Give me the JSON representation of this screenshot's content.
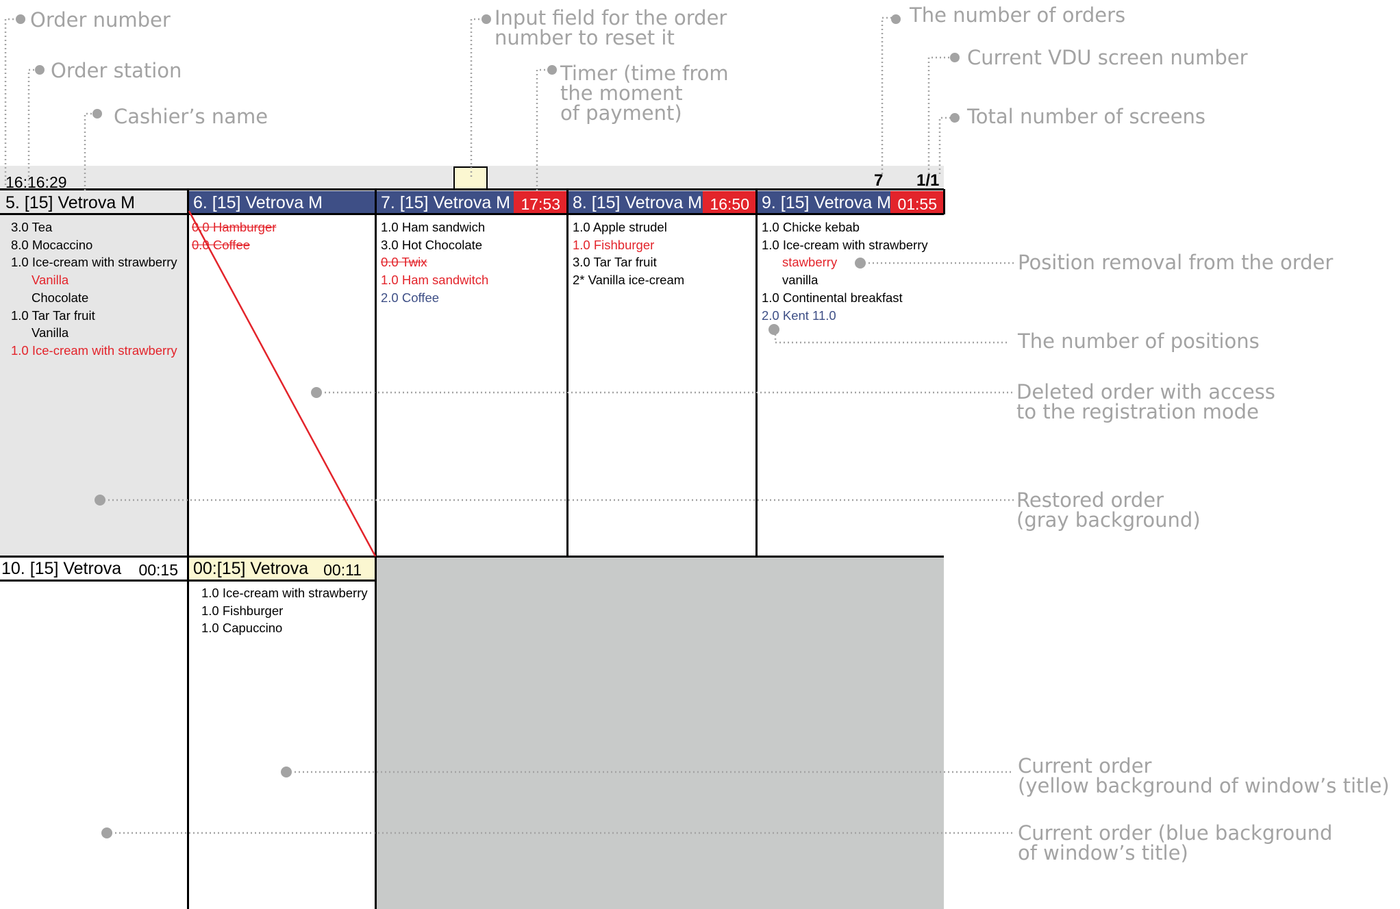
{
  "callouts": {
    "order_number": "Order number",
    "order_station": "Order station",
    "cashier_name": "Cashier’s name",
    "input_field": [
      "Input field for the order",
      "number to reset it"
    ],
    "timer": [
      "Timer (time from",
      "the moment",
      "of payment)"
    ],
    "number_of_orders": "The number of orders",
    "current_screen": "Current VDU screen number",
    "total_screens": "Total number of screens",
    "position_removal": "Position removal from the order",
    "number_of_positions": "The number of positions",
    "deleted_order": [
      "Deleted order with access",
      "to the registration mode"
    ],
    "restored_order": [
      "Restored order",
      "(gray background)"
    ],
    "current_order_yellow": [
      "Current order",
      "(yellow background of window’s title)"
    ],
    "current_order_blue": [
      "Current order (blue background",
      "of window’s title)"
    ]
  },
  "screen": {
    "clock": "16:16:29",
    "orders_count": "7",
    "screen_indicator": "1/1"
  },
  "orders": [
    {
      "title": "5. [15] Vetrova M",
      "header_style": "gray",
      "timer": "",
      "items": [
        {
          "text": "3.0 Tea",
          "style": "normal"
        },
        {
          "text": "8.0 Mocaccino",
          "style": "normal"
        },
        {
          "text": "1.0 Ice-cream with strawberry",
          "style": "normal"
        },
        {
          "text": "Vanilla",
          "style": "red",
          "indent": true
        },
        {
          "text": "Chocolate",
          "style": "normal",
          "indent": true
        },
        {
          "text": "1.0 Tar Tar fruit",
          "style": "normal"
        },
        {
          "text": "Vanilla",
          "style": "normal",
          "indent": true
        },
        {
          "text": "1.0 Ice-cream with strawberry",
          "style": "red"
        }
      ]
    },
    {
      "title": "6. [15] Vetrova M",
      "header_style": "blue",
      "timer": "",
      "items": [
        {
          "text": "0.0 Hamburger",
          "style": "strike"
        },
        {
          "text": "0.0 Coffee",
          "style": "strike"
        }
      ]
    },
    {
      "title": "7. [15] Vetrova M",
      "header_style": "blue",
      "timer": "17:53",
      "items": [
        {
          "text": "1.0 Ham sandwich",
          "style": "normal"
        },
        {
          "text": "3.0 Hot Chocolate",
          "style": "normal"
        },
        {
          "text": "0.0 Twix",
          "style": "strike"
        },
        {
          "text": "1.0 Ham sandwitch",
          "style": "red"
        },
        {
          "text": "2.0 Coffee",
          "style": "blue"
        }
      ]
    },
    {
      "title": "8. [15] Vetrova M",
      "header_style": "blue",
      "timer": "16:50",
      "items": [
        {
          "text": "1.0 Apple strudel",
          "style": "normal"
        },
        {
          "text": "1.0 Fishburger",
          "style": "red"
        },
        {
          "text": "3.0 Tar Tar fruit",
          "style": "normal"
        },
        {
          "text": "2* Vanilla ice-cream",
          "style": "normal"
        }
      ]
    },
    {
      "title": "9. [15] Vetrova M",
      "header_style": "blue",
      "timer": "01:55",
      "items": [
        {
          "text": "1.0 Chicke kebab",
          "style": "normal"
        },
        {
          "text": "1.0 Ice-cream with strawberry",
          "style": "normal"
        },
        {
          "text": "stawberry",
          "style": "red",
          "indent": true
        },
        {
          "text": "vanilla",
          "style": "normal",
          "indent": true
        },
        {
          "text": "1.0 Continental breakfast",
          "style": "normal"
        },
        {
          "text": "2.0 Kent 11.0",
          "style": "blue"
        }
      ]
    },
    {
      "title": "10. [15] Vetrova",
      "header_style": "white",
      "timer_plain": "00:15",
      "items": []
    },
    {
      "title": "00:[15] Vetrova",
      "header_style": "yellow",
      "timer_plain": "00:11",
      "items": [
        {
          "text": "1.0 Ice-cream with strawberry",
          "style": "normal"
        },
        {
          "text": "1.0 Fishburger",
          "style": "normal"
        },
        {
          "text": "1.0 Capuccino",
          "style": "normal"
        }
      ]
    }
  ],
  "colors": {
    "header_blue": "#3e4f86",
    "timer_red": "#e3242b",
    "restored_gray": "#e6e6e6",
    "empty_area": "#c8cac9",
    "current_yellow": "#fbf7d1",
    "callout_gray": "#a3a3a3"
  }
}
